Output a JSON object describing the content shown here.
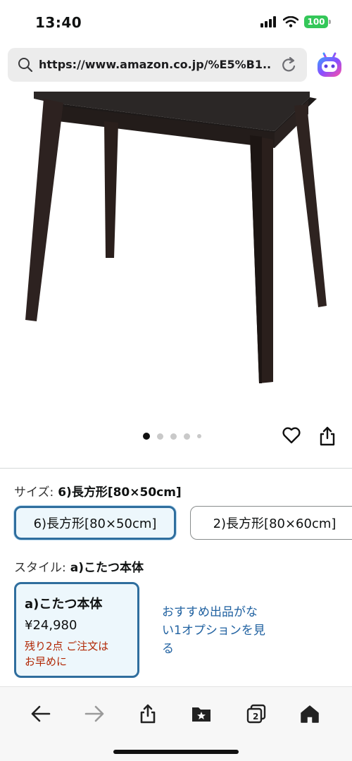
{
  "status_bar": {
    "time": "13:40",
    "battery": "100"
  },
  "browser": {
    "url": "https://www.amazon.co.jp/%E5%B1...",
    "tab_count": "2"
  },
  "product": {
    "carousel": {
      "count": 5,
      "active_index": 0
    },
    "size": {
      "label": "サイズ:",
      "selected_value": "6)長方形[80×50cm]",
      "options": [
        "6)長方形[80×50cm]",
        "2)長方形[80×60cm]"
      ]
    },
    "style": {
      "label": "スタイル:",
      "selected_value": "a)こたつ本体",
      "card": {
        "title": "a)こたつ本体",
        "price": "¥24,980",
        "stock_line1": "残り2点 ご注文は",
        "stock_line2": "お早めに"
      },
      "no_offer_link_line1": "おすすめ出品がな",
      "no_offer_link_line2": "い1オプションを見",
      "no_offer_link_line3": "る"
    }
  },
  "colors": {
    "accent_blue": "#2f6e9e",
    "selected_bg": "#edf7fc",
    "link": "#2162a1",
    "stock_red": "#b12704",
    "battery_green": "#34c759"
  }
}
